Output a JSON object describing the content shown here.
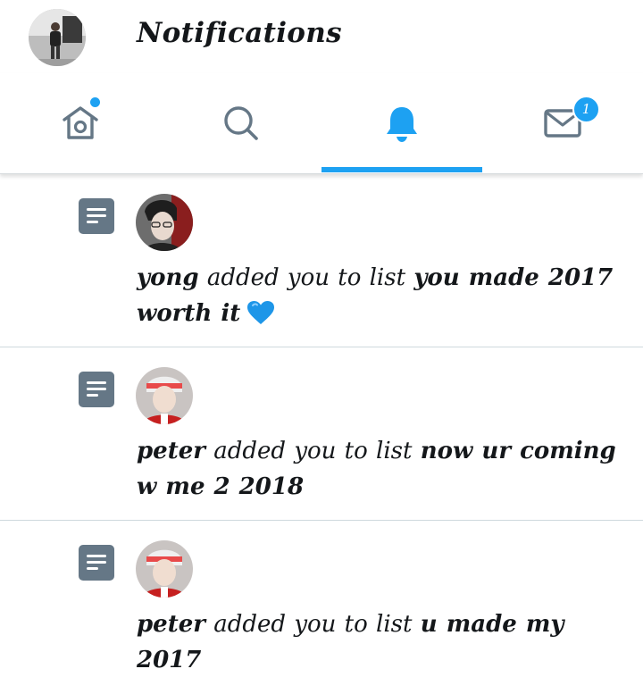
{
  "header": {
    "title": "Notifications"
  },
  "tabs": [
    {
      "name": "home",
      "icon": "home-icon",
      "active": false,
      "has_dot": true
    },
    {
      "name": "search",
      "icon": "search-icon",
      "active": false
    },
    {
      "name": "notifications",
      "icon": "bell-icon",
      "active": true
    },
    {
      "name": "messages",
      "icon": "mail-icon",
      "active": false,
      "badge": "1"
    }
  ],
  "colors": {
    "accent": "#1da1f2",
    "icon_inactive": "#657786",
    "text": "#14171a",
    "divider": "#cfd9de"
  },
  "notifications": [
    {
      "user": "yong",
      "action": "added you to list",
      "list_name": "you made 2017 worth it",
      "emoji": "blue-heart",
      "icon": "list-icon"
    },
    {
      "user": "peter",
      "action": "added you to list",
      "list_name": "now ur coming w me 2 2018",
      "icon": "list-icon"
    },
    {
      "user": "peter",
      "action": "added you to list",
      "list_name": "u made my 2017",
      "icon": "list-icon"
    }
  ]
}
